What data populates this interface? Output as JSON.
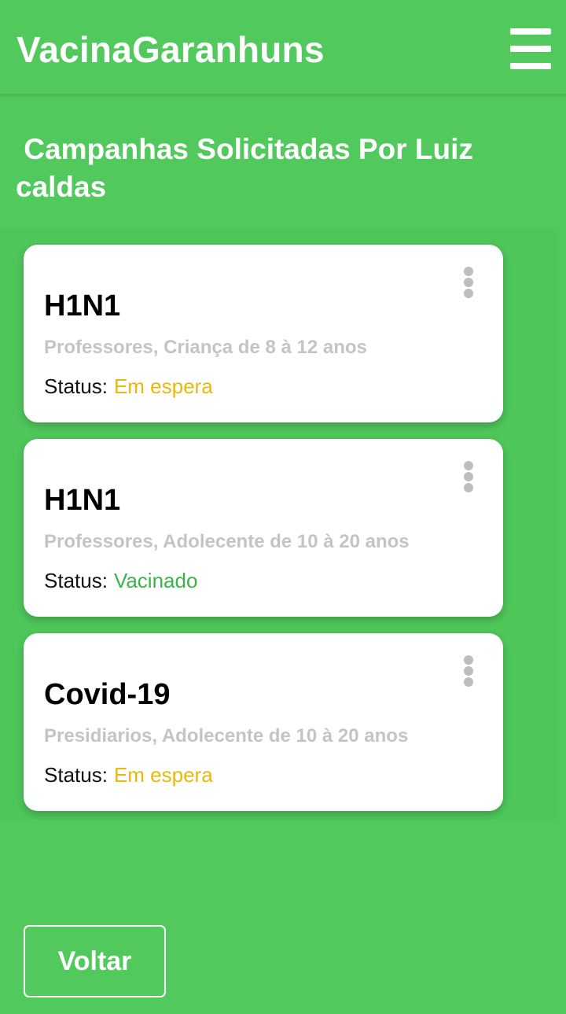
{
  "header": {
    "title": "VacinaGaranhuns",
    "menu_icon": "hamburger-menu-icon"
  },
  "page": {
    "heading": " Campanhas Solicitadas Por Luiz caldas"
  },
  "campaigns": [
    {
      "name": "H1N1",
      "groups": "Professores, Criança de 8 à 12 anos",
      "status_label": "Status:",
      "status_value": "Em espera",
      "status_color": "#e8b90c"
    },
    {
      "name": "H1N1",
      "groups": "Professores, Adolecente de 10 à 20 anos",
      "status_label": "Status:",
      "status_value": "Vacinado",
      "status_color": "#3ab44a"
    },
    {
      "name": "Covid-19",
      "groups": "Presidiarios, Adolecente de 10 à 20 anos",
      "status_label": "Status:",
      "status_value": "Em espera",
      "status_color": "#e8b90c"
    }
  ],
  "footer": {
    "back_label": "Voltar"
  },
  "colors": {
    "primary_green": "#52c95d",
    "pending": "#e8b90c",
    "vaccinated": "#3ab44a"
  }
}
